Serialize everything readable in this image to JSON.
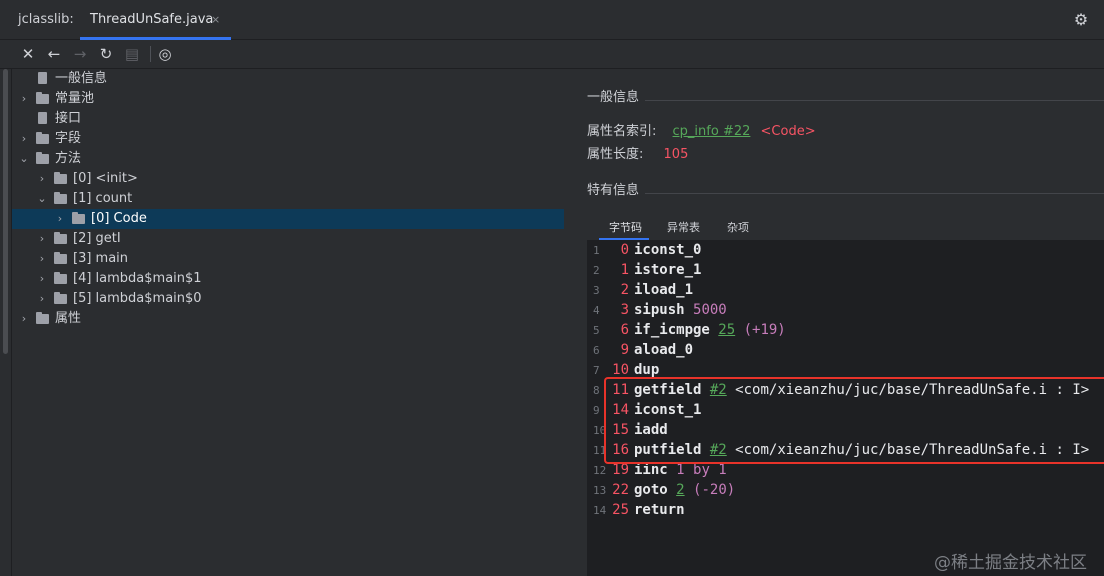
{
  "header": {
    "plugin_label": "jclasslib:",
    "tab_label": "ThreadUnSafe.java",
    "tab_close": "×"
  },
  "toolbar": {
    "close": "✕",
    "back": "←",
    "forward": "→",
    "refresh": "↻",
    "save": "▤",
    "browse": "◎"
  },
  "tree": [
    {
      "label": "一般信息",
      "expand": "",
      "icon": "file"
    },
    {
      "label": "常量池",
      "expand": "›",
      "icon": "folder"
    },
    {
      "label": "接口",
      "expand": "",
      "icon": "file"
    },
    {
      "label": "字段",
      "expand": "›",
      "icon": "folder"
    },
    {
      "label": "方法",
      "expand": "⌄",
      "icon": "folder"
    },
    {
      "label": "[0] <init>",
      "expand": "›",
      "icon": "folder"
    },
    {
      "label": "[1] count",
      "expand": "⌄",
      "icon": "folder"
    },
    {
      "label": "[0] Code",
      "expand": "›",
      "icon": "folder",
      "selected": true
    },
    {
      "label": "[2] getI",
      "expand": "›",
      "icon": "folder"
    },
    {
      "label": "[3] main",
      "expand": "›",
      "icon": "folder"
    },
    {
      "label": "[4] lambda$main$1",
      "expand": "›",
      "icon": "folder"
    },
    {
      "label": "[5] lambda$main$0",
      "expand": "›",
      "icon": "folder"
    },
    {
      "label": "属性",
      "expand": "›",
      "icon": "folder"
    }
  ],
  "general": {
    "title": "一般信息",
    "name_index_label": "属性名索引:",
    "name_index_link": "cp_info #22",
    "name_index_value": "<Code>",
    "length_label": "属性长度:",
    "length_value": "105"
  },
  "specific": {
    "title": "特有信息",
    "tabs": [
      "字节码",
      "异常表",
      "杂项"
    ]
  },
  "bytecode": [
    {
      "ln": "1",
      "off": "0",
      "op": "iconst_0"
    },
    {
      "ln": "2",
      "off": "1",
      "op": "istore_1"
    },
    {
      "ln": "3",
      "off": "2",
      "op": "iload_1"
    },
    {
      "ln": "4",
      "off": "3",
      "op": "sipush",
      "num": "5000"
    },
    {
      "ln": "5",
      "off": "6",
      "op": "if_icmpge",
      "ref": "25",
      "num": "(+19)"
    },
    {
      "ln": "6",
      "off": "9",
      "op": "aload_0"
    },
    {
      "ln": "7",
      "off": "10",
      "op": "dup"
    },
    {
      "ln": "8",
      "off": "11",
      "op": "getfield",
      "ref": "#2",
      "sig": "<com/xieanzhu/juc/base/ThreadUnSafe.i : I>"
    },
    {
      "ln": "9",
      "off": "14",
      "op": "iconst_1"
    },
    {
      "ln": "10",
      "off": "15",
      "op": "iadd"
    },
    {
      "ln": "11",
      "off": "16",
      "op": "putfield",
      "ref": "#2",
      "sig": "<com/xieanzhu/juc/base/ThreadUnSafe.i : I>"
    },
    {
      "ln": "12",
      "off": "19",
      "op": "iinc",
      "num": "1 by 1"
    },
    {
      "ln": "13",
      "off": "22",
      "op": "goto",
      "ref": "2",
      "num": "(-20)"
    },
    {
      "ln": "14",
      "off": "25",
      "op": "return"
    }
  ],
  "watermark": "@稀土掘金技术社区",
  "colors": {
    "accent": "#3574f0",
    "offset": "#f75464",
    "number": "#c77dbb",
    "link": "#56a85a",
    "highlight": "#e8332a"
  }
}
